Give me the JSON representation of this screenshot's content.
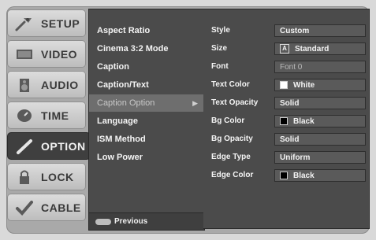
{
  "colors": {
    "panel": "#4b4b4b",
    "highlight": "#6e6e6e",
    "sidebar_active": "#3f3f3f",
    "sidebar_inactive": "#cdcdcd",
    "text": "#f4f4f4",
    "swatch_white": "#ffffff",
    "swatch_black": "#000000"
  },
  "sidebar": {
    "items": [
      {
        "label": "SETUP",
        "icon": "wrench-satellite-icon"
      },
      {
        "label": "VIDEO",
        "icon": "tv-monitor-icon"
      },
      {
        "label": "AUDIO",
        "icon": "speaker-icon"
      },
      {
        "label": "TIME",
        "icon": "clock-icon"
      },
      {
        "label": "OPTION",
        "icon": "pen-icon"
      },
      {
        "label": "LOCK",
        "icon": "lock-icon"
      },
      {
        "label": "CABLE",
        "icon": "cable-check-icon"
      }
    ],
    "active": "OPTION"
  },
  "menu": {
    "items": [
      "Aspect Ratio",
      "Cinema 3:2 Mode",
      "Caption",
      "Caption/Text",
      "Caption Option",
      "Language",
      "ISM Method",
      "Low Power"
    ],
    "highlighted": "Caption Option",
    "arrow": "▶",
    "footer_label": "Previous"
  },
  "options": [
    {
      "label": "Style",
      "value": "Custom"
    },
    {
      "label": "Size",
      "value": "Standard",
      "prefix_glyph": "A"
    },
    {
      "label": "Font",
      "value": "Font 0"
    },
    {
      "label": "Text Color",
      "value": "White"
    },
    {
      "label": "Text Opacity",
      "value": "Solid"
    },
    {
      "label": "Bg Color",
      "value": "Black"
    },
    {
      "label": "Bg Opacity",
      "value": "Solid"
    },
    {
      "label": "Edge Type",
      "value": "Uniform"
    },
    {
      "label": "Edge Color",
      "value": "Black"
    }
  ]
}
